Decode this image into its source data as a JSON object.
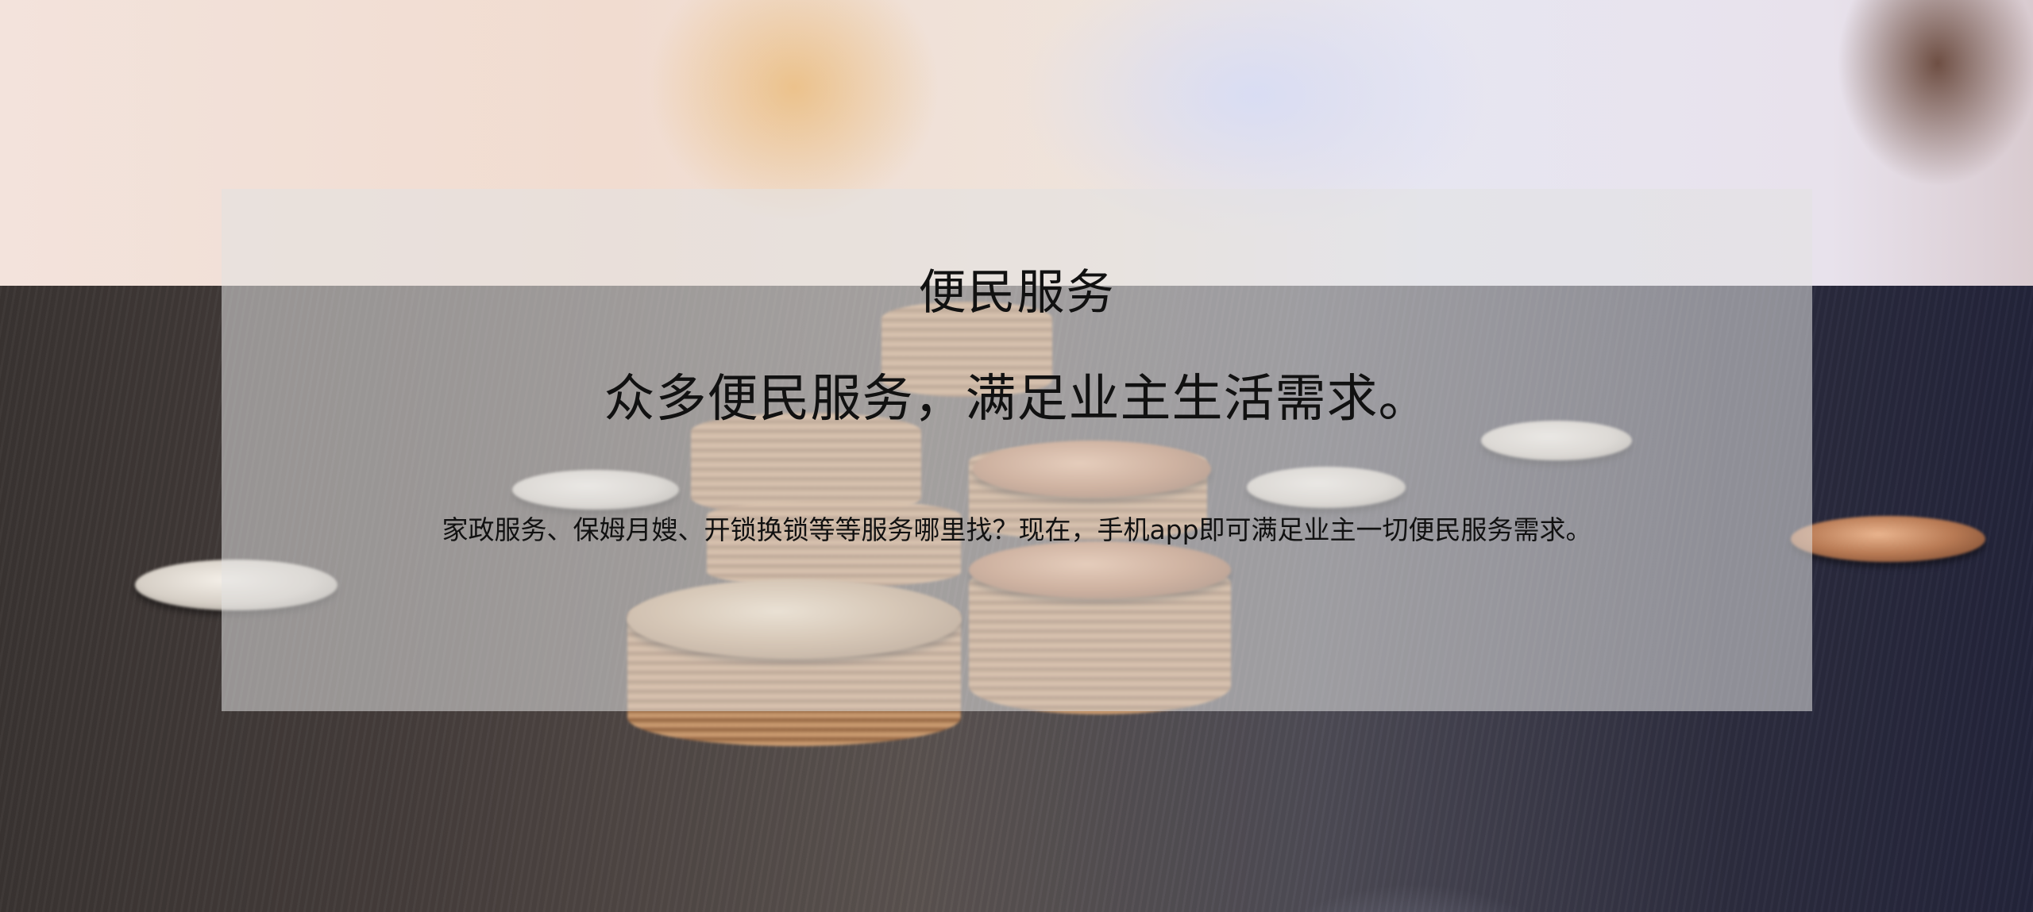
{
  "service_section": {
    "title": "便民服务",
    "headline": "众多便民服务，满足业主生活需求。",
    "description": "家政服务、保姆月嫂、开锁换锁等等服务哪里找？现在，手机app即可满足业主一切便民服务需求。"
  },
  "background": {
    "subject": "coins-on-table-photo",
    "overlay_color": "#e1e1e1"
  }
}
